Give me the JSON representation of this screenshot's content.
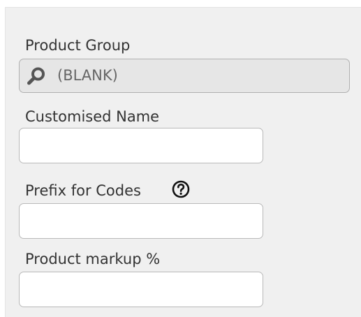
{
  "form": {
    "product_group": {
      "label": "Product Group",
      "value": "(BLANK)",
      "icon": "search-icon"
    },
    "customised_name": {
      "label": "Customised Name",
      "value": ""
    },
    "prefix_for_codes": {
      "label": "Prefix for Codes",
      "value": "",
      "help_icon": "question-circle-icon"
    },
    "product_markup": {
      "label": "Product markup %",
      "value": ""
    }
  },
  "colors": {
    "panel_background": "#f0f0f0",
    "search_field_background": "#e6e6e6",
    "input_background": "#ffffff",
    "border": "#b9b9b9",
    "label_text": "#333333"
  }
}
